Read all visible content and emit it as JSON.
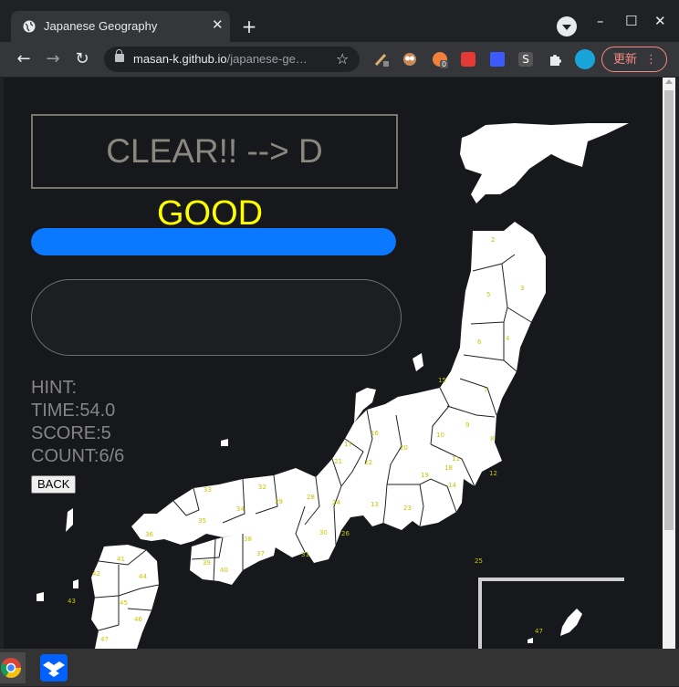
{
  "browser": {
    "tab_title": "Japanese Geography",
    "tab_close": "✕",
    "new_tab": "+",
    "url_host": "masan-k.github.io",
    "url_path": "/japanese-ge…",
    "update_label": "更新",
    "menu_dots": "⋮",
    "win_minimize": "–",
    "win_maximize": "☐",
    "win_close": "✕",
    "back": "←",
    "forward": "→",
    "reload": "↻",
    "bookmark": "☆",
    "ext_badge": "0",
    "ext_s": "S"
  },
  "game": {
    "result_text": "CLEAR!! --> D",
    "feedback": "GOOD",
    "progress": 1.0,
    "hint_label": "HINT:",
    "time_label": "TIME:54.0",
    "score_label": "SCORE:5",
    "count_label": "COUNT:6/6",
    "back_button": "BACK"
  },
  "map": {
    "prefecture_labels": [
      "2",
      "3",
      "5",
      "4",
      "6",
      "7",
      "15",
      "9",
      "8",
      "10",
      "16",
      "17",
      "20",
      "11",
      "12",
      "14",
      "19",
      "18",
      "21",
      "22",
      "23",
      "13",
      "25",
      "24",
      "26",
      "28",
      "29",
      "30",
      "31",
      "32",
      "33",
      "34",
      "35",
      "36",
      "37",
      "38",
      "39",
      "40",
      "41",
      "42",
      "43",
      "44",
      "45",
      "46",
      "47"
    ]
  },
  "colors": {
    "progress": "#0a78ff",
    "feedback": "#ffff00",
    "map_fill": "#ffffff",
    "label": "#c8c800"
  }
}
